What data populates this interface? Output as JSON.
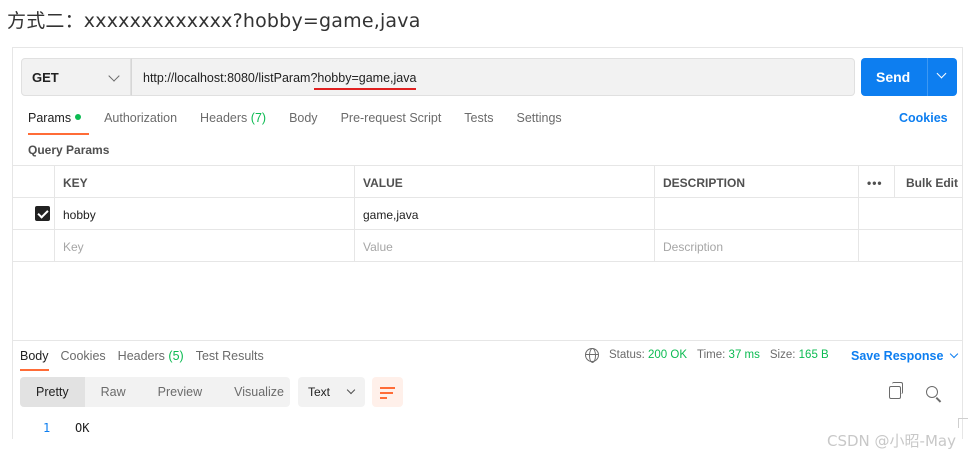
{
  "caption": "方式二：xxxxxxxxxxxxx?hobby=game,java",
  "request": {
    "method": "GET",
    "url": "http://localhost:8080/listParam?hobby=game,java",
    "send_label": "Send"
  },
  "request_tabs": [
    {
      "label": "Params",
      "dot_color": "#0cbb52"
    },
    {
      "label": "Authorization"
    },
    {
      "label": "Headers",
      "count": "(7)"
    },
    {
      "label": "Body"
    },
    {
      "label": "Pre-request Script"
    },
    {
      "label": "Tests"
    },
    {
      "label": "Settings"
    }
  ],
  "cookies_label": "Cookies",
  "query_params_title": "Query Params",
  "params_table": {
    "headers": [
      "KEY",
      "VALUE",
      "DESCRIPTION",
      "Bulk Edit"
    ],
    "rows": [
      {
        "checked": true,
        "key": "hobby",
        "value": "game,java",
        "description": ""
      }
    ],
    "placeholders": {
      "key": "Key",
      "value": "Value",
      "description": "Description"
    }
  },
  "response": {
    "tabs": [
      {
        "label": "Body"
      },
      {
        "label": "Cookies"
      },
      {
        "label": "Headers",
        "count": "(5)"
      },
      {
        "label": "Test Results"
      }
    ],
    "status_label": "Status:",
    "status_value": "200 OK",
    "time_label": "Time:",
    "time_value": "37 ms",
    "size_label": "Size:",
    "size_value": "165 B",
    "save_label": "Save Response",
    "view_tabs": [
      "Pretty",
      "Raw",
      "Preview",
      "Visualize"
    ],
    "format": "Text",
    "line_number": "1",
    "line_text": "OK"
  },
  "colors": {
    "accent": "#0d7ef0",
    "active_tab": "#ff6c37",
    "success": "#0cbb52"
  },
  "watermark": "CSDN @小昭-May"
}
